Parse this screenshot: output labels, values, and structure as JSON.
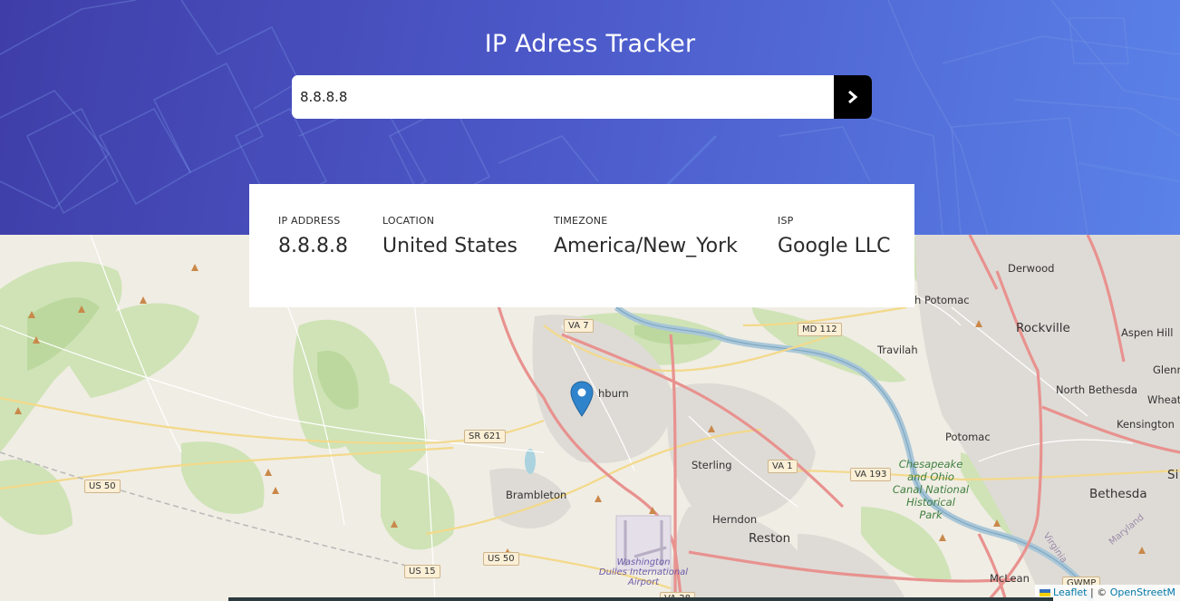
{
  "header": {
    "title": "IP Adress Tracker"
  },
  "search": {
    "value": "8.8.8.8",
    "submit_icon": "chevron-right-icon"
  },
  "info": {
    "ip": {
      "label": "IP ADDRESS",
      "value": "8.8.8.8"
    },
    "location": {
      "label": "LOCATION",
      "value": "United States"
    },
    "timezone": {
      "label": "TIMEZONE",
      "value": "America/New_York"
    },
    "isp": {
      "label": "ISP",
      "value": "Google LLC"
    }
  },
  "map": {
    "places": {
      "ashburn": "hburn",
      "sterling": "Sterling",
      "brambleton": "Brambleton",
      "herndon": "Herndon",
      "reston": "Reston",
      "travilah": "Travilah",
      "potomac": "Potomac",
      "rockville": "Rockville",
      "derwood": "Derwood",
      "aspen_hill": "Aspen Hill",
      "north_bethesda": "North Bethesda",
      "kensington": "Kensington",
      "bethesda": "Bethesda",
      "mclean": "McLean",
      "north_potomac": "h Potomac",
      "glenmont": "Glenn",
      "wheaton": "Wheato",
      "silver_spring": "Si",
      "canal_line1": "Chesapeake",
      "canal_line2": "and Ohio",
      "canal_line3": "Canal National",
      "canal_line4": "Historical",
      "canal_line5": "Park",
      "airport_line1": "Washington",
      "airport_line2": "Dulles International",
      "airport_line3": "Airport",
      "maryland": "Maryland",
      "virginia": "Virginia"
    },
    "shields": {
      "va7": "VA 7",
      "md112": "MD 112",
      "sr621": "SR 621",
      "va1": "VA 1",
      "va193": "VA 193",
      "us50a": "US 50",
      "us50b": "US 50",
      "us15": "US 15",
      "va28": "VA 28",
      "gwmp": "GWMP"
    },
    "attribution": {
      "leaflet": "Leaflet",
      "separator": "| ©",
      "osm": "OpenStreetM"
    },
    "marker_icon": "map-pin-icon"
  }
}
